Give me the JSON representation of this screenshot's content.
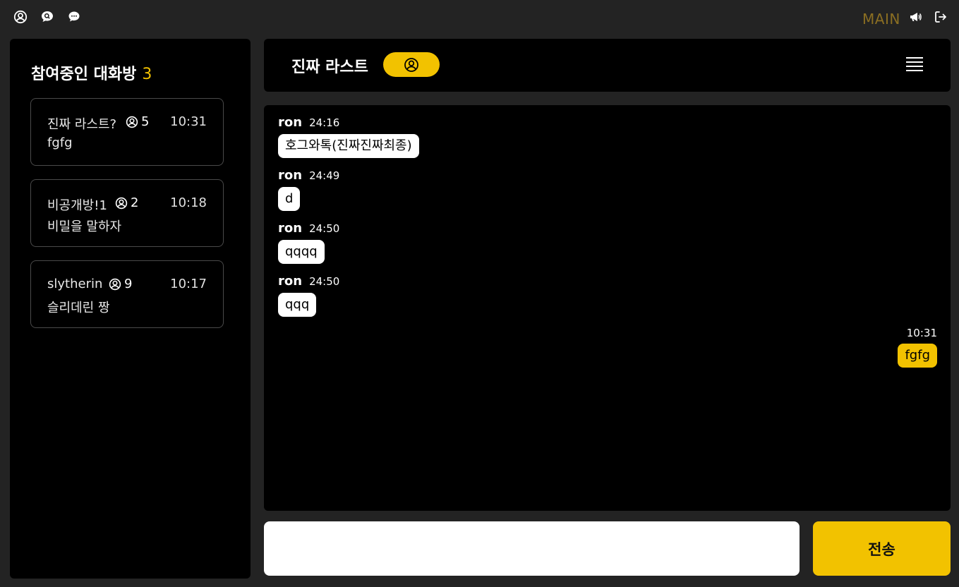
{
  "topbar": {
    "icons": [
      "user-circle-icon",
      "search-chat-icon",
      "chat-bubble-icon",
      "megaphone-icon",
      "logout-icon"
    ],
    "main_label": "MAIN"
  },
  "sidebar": {
    "title": "참여중인 대화방",
    "count": "3",
    "rooms": [
      {
        "name": "진짜 라스트?",
        "members": "5",
        "time": "10:31",
        "last_message": "fgfg"
      },
      {
        "name": "비공개방!1",
        "members": "2",
        "time": "10:18",
        "last_message": "비밀을 말하자"
      },
      {
        "name": "slytherin",
        "members": "9",
        "time": "10:17",
        "last_message": "슬리데린 짱"
      }
    ]
  },
  "chat": {
    "title": "진짜 라스트",
    "messages": [
      {
        "sender": "ron",
        "time": "24:16",
        "text": "호그와톡(진짜진짜최종)"
      },
      {
        "sender": "ron",
        "time": "24:49",
        "text": "d"
      },
      {
        "sender": "ron",
        "time": "24:50",
        "text": "qqqq"
      },
      {
        "sender": "ron",
        "time": "24:50",
        "text": "qqq"
      }
    ],
    "my_message": {
      "time": "10:31",
      "text": "fgfg"
    }
  },
  "composer": {
    "value": "",
    "placeholder": "",
    "send_label": "전송"
  },
  "colors": {
    "accent": "#f2c200",
    "background": "#232323",
    "panel": "#000000",
    "main_link": "#8a6e22"
  }
}
